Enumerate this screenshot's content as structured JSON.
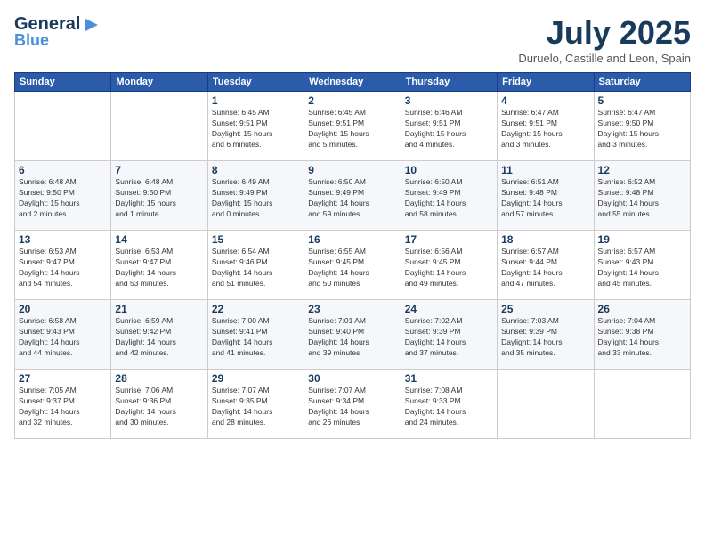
{
  "logo": {
    "line1": "General",
    "line2": "Blue",
    "icon": "▶"
  },
  "header": {
    "title": "July 2025",
    "subtitle": "Duruelo, Castille and Leon, Spain"
  },
  "weekdays": [
    "Sunday",
    "Monday",
    "Tuesday",
    "Wednesday",
    "Thursday",
    "Friday",
    "Saturday"
  ],
  "weeks": [
    [
      {
        "day": "",
        "info": ""
      },
      {
        "day": "",
        "info": ""
      },
      {
        "day": "1",
        "info": "Sunrise: 6:45 AM\nSunset: 9:51 PM\nDaylight: 15 hours\nand 6 minutes."
      },
      {
        "day": "2",
        "info": "Sunrise: 6:45 AM\nSunset: 9:51 PM\nDaylight: 15 hours\nand 5 minutes."
      },
      {
        "day": "3",
        "info": "Sunrise: 6:46 AM\nSunset: 9:51 PM\nDaylight: 15 hours\nand 4 minutes."
      },
      {
        "day": "4",
        "info": "Sunrise: 6:47 AM\nSunset: 9:51 PM\nDaylight: 15 hours\nand 3 minutes."
      },
      {
        "day": "5",
        "info": "Sunrise: 6:47 AM\nSunset: 9:50 PM\nDaylight: 15 hours\nand 3 minutes."
      }
    ],
    [
      {
        "day": "6",
        "info": "Sunrise: 6:48 AM\nSunset: 9:50 PM\nDaylight: 15 hours\nand 2 minutes."
      },
      {
        "day": "7",
        "info": "Sunrise: 6:48 AM\nSunset: 9:50 PM\nDaylight: 15 hours\nand 1 minute."
      },
      {
        "day": "8",
        "info": "Sunrise: 6:49 AM\nSunset: 9:49 PM\nDaylight: 15 hours\nand 0 minutes."
      },
      {
        "day": "9",
        "info": "Sunrise: 6:50 AM\nSunset: 9:49 PM\nDaylight: 14 hours\nand 59 minutes."
      },
      {
        "day": "10",
        "info": "Sunrise: 6:50 AM\nSunset: 9:49 PM\nDaylight: 14 hours\nand 58 minutes."
      },
      {
        "day": "11",
        "info": "Sunrise: 6:51 AM\nSunset: 9:48 PM\nDaylight: 14 hours\nand 57 minutes."
      },
      {
        "day": "12",
        "info": "Sunrise: 6:52 AM\nSunset: 9:48 PM\nDaylight: 14 hours\nand 55 minutes."
      }
    ],
    [
      {
        "day": "13",
        "info": "Sunrise: 6:53 AM\nSunset: 9:47 PM\nDaylight: 14 hours\nand 54 minutes."
      },
      {
        "day": "14",
        "info": "Sunrise: 6:53 AM\nSunset: 9:47 PM\nDaylight: 14 hours\nand 53 minutes."
      },
      {
        "day": "15",
        "info": "Sunrise: 6:54 AM\nSunset: 9:46 PM\nDaylight: 14 hours\nand 51 minutes."
      },
      {
        "day": "16",
        "info": "Sunrise: 6:55 AM\nSunset: 9:45 PM\nDaylight: 14 hours\nand 50 minutes."
      },
      {
        "day": "17",
        "info": "Sunrise: 6:56 AM\nSunset: 9:45 PM\nDaylight: 14 hours\nand 49 minutes."
      },
      {
        "day": "18",
        "info": "Sunrise: 6:57 AM\nSunset: 9:44 PM\nDaylight: 14 hours\nand 47 minutes."
      },
      {
        "day": "19",
        "info": "Sunrise: 6:57 AM\nSunset: 9:43 PM\nDaylight: 14 hours\nand 45 minutes."
      }
    ],
    [
      {
        "day": "20",
        "info": "Sunrise: 6:58 AM\nSunset: 9:43 PM\nDaylight: 14 hours\nand 44 minutes."
      },
      {
        "day": "21",
        "info": "Sunrise: 6:59 AM\nSunset: 9:42 PM\nDaylight: 14 hours\nand 42 minutes."
      },
      {
        "day": "22",
        "info": "Sunrise: 7:00 AM\nSunset: 9:41 PM\nDaylight: 14 hours\nand 41 minutes."
      },
      {
        "day": "23",
        "info": "Sunrise: 7:01 AM\nSunset: 9:40 PM\nDaylight: 14 hours\nand 39 minutes."
      },
      {
        "day": "24",
        "info": "Sunrise: 7:02 AM\nSunset: 9:39 PM\nDaylight: 14 hours\nand 37 minutes."
      },
      {
        "day": "25",
        "info": "Sunrise: 7:03 AM\nSunset: 9:39 PM\nDaylight: 14 hours\nand 35 minutes."
      },
      {
        "day": "26",
        "info": "Sunrise: 7:04 AM\nSunset: 9:38 PM\nDaylight: 14 hours\nand 33 minutes."
      }
    ],
    [
      {
        "day": "27",
        "info": "Sunrise: 7:05 AM\nSunset: 9:37 PM\nDaylight: 14 hours\nand 32 minutes."
      },
      {
        "day": "28",
        "info": "Sunrise: 7:06 AM\nSunset: 9:36 PM\nDaylight: 14 hours\nand 30 minutes."
      },
      {
        "day": "29",
        "info": "Sunrise: 7:07 AM\nSunset: 9:35 PM\nDaylight: 14 hours\nand 28 minutes."
      },
      {
        "day": "30",
        "info": "Sunrise: 7:07 AM\nSunset: 9:34 PM\nDaylight: 14 hours\nand 26 minutes."
      },
      {
        "day": "31",
        "info": "Sunrise: 7:08 AM\nSunset: 9:33 PM\nDaylight: 14 hours\nand 24 minutes."
      },
      {
        "day": "",
        "info": ""
      },
      {
        "day": "",
        "info": ""
      }
    ]
  ]
}
